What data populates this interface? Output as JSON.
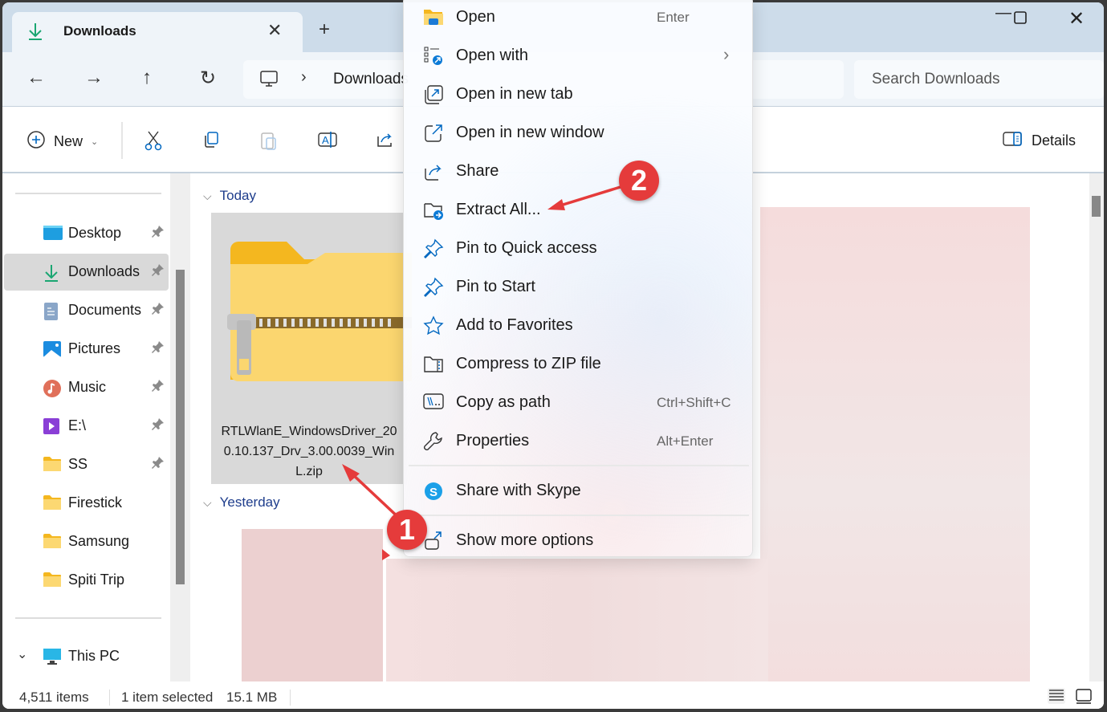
{
  "window": {
    "tab_title": "Downloads",
    "tab_icon": "download-icon",
    "controls": [
      "minimize-icon",
      "maximize-icon",
      "close-icon"
    ]
  },
  "nav": {
    "address_path": [
      "This PC",
      "Downloads"
    ],
    "search_placeholder": "Search Downloads"
  },
  "toolbar": {
    "new_label": "New",
    "details_label": "Details",
    "icons": [
      "cut-icon",
      "copy-icon",
      "paste-icon",
      "rename-icon",
      "share-icon"
    ]
  },
  "sidebar": {
    "items": [
      {
        "label": "Desktop",
        "icon": "desktop-icon",
        "pinned": true
      },
      {
        "label": "Downloads",
        "icon": "download-icon",
        "pinned": true,
        "selected": true
      },
      {
        "label": "Documents",
        "icon": "documents-icon",
        "pinned": true
      },
      {
        "label": "Pictures",
        "icon": "pictures-icon",
        "pinned": true
      },
      {
        "label": "Music",
        "icon": "music-icon",
        "pinned": true
      },
      {
        "label": "E:\\",
        "icon": "video-drive-icon",
        "pinned": true
      },
      {
        "label": "SS",
        "icon": "folder-icon",
        "pinned": true
      },
      {
        "label": "Firestick",
        "icon": "folder-icon",
        "pinned": false
      },
      {
        "label": "Samsung",
        "icon": "folder-icon",
        "pinned": false
      },
      {
        "label": "Spiti Trip",
        "icon": "folder-icon",
        "pinned": false
      }
    ],
    "this_pc_label": "This PC"
  },
  "content": {
    "groups": [
      {
        "label": "Today"
      },
      {
        "label": "Yesterday"
      }
    ],
    "selected_file": {
      "name_lines": [
        "RTLWlanE_WindowsDriver_20",
        "0.10.137_Drv_3.00.0039_Win",
        "L.zip"
      ],
      "icon": "zip-folder-icon"
    }
  },
  "context_menu": {
    "items": [
      {
        "label": "Open",
        "shortcut": "Enter",
        "icon": "folder-open-icon"
      },
      {
        "label": "Open with",
        "submenu": true,
        "icon": "open-with-icon"
      },
      {
        "label": "Open in new tab",
        "icon": "new-tab-icon"
      },
      {
        "label": "Open in new window",
        "icon": "new-window-icon"
      },
      {
        "label": "Share",
        "icon": "share-icon"
      },
      {
        "label": "Extract All...",
        "icon": "extract-icon"
      },
      {
        "label": "Pin to Quick access",
        "icon": "pin-icon"
      },
      {
        "label": "Pin to Start",
        "icon": "pin-icon"
      },
      {
        "label": "Add to Favorites",
        "icon": "star-icon"
      },
      {
        "label": "Compress to ZIP file",
        "icon": "zip-icon"
      },
      {
        "label": "Copy as path",
        "shortcut": "Ctrl+Shift+C",
        "icon": "copy-path-icon"
      },
      {
        "label": "Properties",
        "shortcut": "Alt+Enter",
        "icon": "wrench-icon"
      }
    ],
    "skype_label": "Share with Skype",
    "more_label": "Show more options"
  },
  "annotations": {
    "badge1": "1",
    "badge2": "2",
    "color": "#e53b3b"
  },
  "status": {
    "item_count": "4,511 items",
    "selection": "1 item selected",
    "size": "15.1 MB"
  }
}
